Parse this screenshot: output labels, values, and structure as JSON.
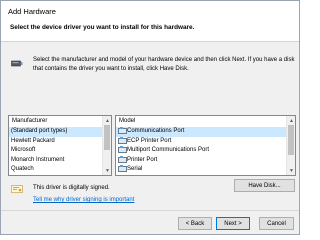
{
  "window": {
    "title": "Add Hardware"
  },
  "header": {
    "title": "Select the device driver you want to install for this hardware."
  },
  "description": "Select the manufacturer and model of your hardware device and then click Next. If you have a disk that contains the driver you want to install, click Have Disk.",
  "manufacturer_list": {
    "header": "Manufacturer",
    "items": [
      {
        "label": "(Standard port types)",
        "selected": true
      },
      {
        "label": "Hewlett Packard",
        "selected": false
      },
      {
        "label": "Microsoft",
        "selected": false
      },
      {
        "label": "Monarch Instrument",
        "selected": false
      },
      {
        "label": "Quatech",
        "selected": false
      }
    ]
  },
  "model_list": {
    "header": "Model",
    "items": [
      {
        "label": "Communications Port",
        "selected": true
      },
      {
        "label": "ECP Printer Port",
        "selected": false
      },
      {
        "label": "Multiport Communications Port",
        "selected": false
      },
      {
        "label": "Printer Port",
        "selected": false
      },
      {
        "label": "Serial",
        "selected": false
      }
    ]
  },
  "signed": {
    "text": "This driver is digitally signed."
  },
  "sign_link": "Tell me why driver signing is important",
  "buttons": {
    "have_disk": "Have Disk...",
    "back": "< Back",
    "next": "Next >",
    "cancel": "Cancel"
  },
  "colors": {
    "selection": "#cce8ff",
    "link": "#0066cc",
    "default_button_border": "#0078d7"
  }
}
